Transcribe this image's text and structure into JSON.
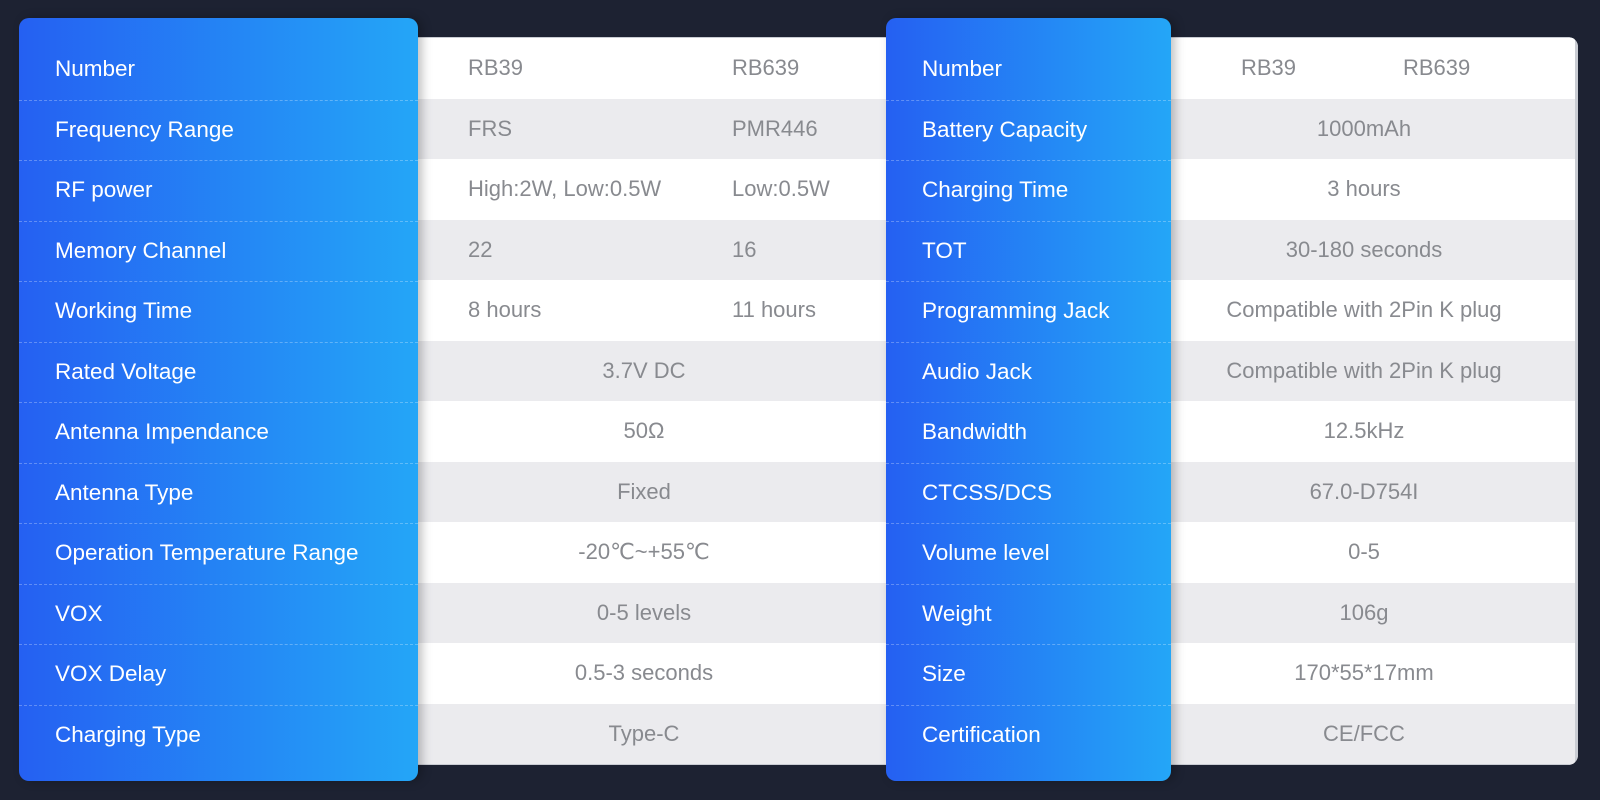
{
  "left_table": {
    "rows": [
      {
        "label": "Number",
        "a": "RB39",
        "b": "RB639"
      },
      {
        "label": "Frequency Range",
        "a": "FRS",
        "b": "PMR446"
      },
      {
        "label": "RF power",
        "a": "High:2W, Low:0.5W",
        "b": "Low:0.5W"
      },
      {
        "label": "Memory Channel",
        "a": "22",
        "b": "16"
      },
      {
        "label": "Working Time",
        "a": "8 hours",
        "b": "11 hours"
      },
      {
        "label": "Rated Voltage",
        "value": "3.7V DC"
      },
      {
        "label": "Antenna Impendance",
        "value": "50Ω"
      },
      {
        "label": "Antenna Type",
        "value": "Fixed"
      },
      {
        "label": "Operation Temperature Range",
        "value": "-20℃~+55℃"
      },
      {
        "label": "VOX",
        "value": "0-5 levels"
      },
      {
        "label": "VOX Delay",
        "value": "0.5-3 seconds"
      },
      {
        "label": "Charging Type",
        "value": "Type-C"
      }
    ]
  },
  "right_table": {
    "rows": [
      {
        "label": "Number",
        "a": "RB39",
        "b": "RB639"
      },
      {
        "label": "Battery Capacity",
        "value": "1000mAh"
      },
      {
        "label": "Charging Time",
        "value": "3 hours"
      },
      {
        "label": "TOT",
        "value": "30-180 seconds"
      },
      {
        "label": "Programming Jack",
        "value": "Compatible with 2Pin K plug"
      },
      {
        "label": "Audio Jack",
        "value": "Compatible with 2Pin K plug"
      },
      {
        "label": "Bandwidth",
        "value": "12.5kHz"
      },
      {
        "label": "CTCSS/DCS",
        "value": "67.0-D754I"
      },
      {
        "label": "Volume level",
        "value": "0-5"
      },
      {
        "label": "Weight",
        "value": "106g"
      },
      {
        "label": "Size",
        "value": "170*55*17mm"
      },
      {
        "label": "Certification",
        "value": "CE/FCC"
      }
    ]
  },
  "colors": {
    "background": "#1d2232",
    "label_gradient_start": "#2560f2",
    "label_gradient_end": "#24a6f7",
    "row_stripe": "#ebebee",
    "value_text": "#888a8f"
  }
}
